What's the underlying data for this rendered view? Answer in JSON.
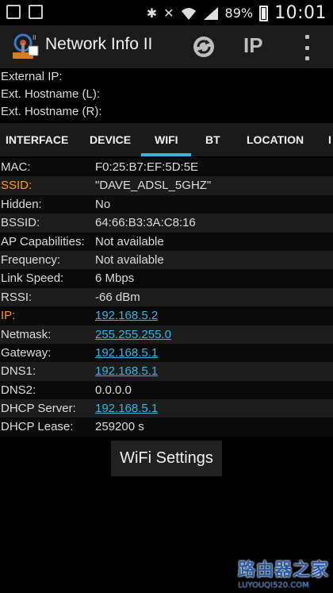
{
  "status": {
    "battery": "89%",
    "time": "10:01"
  },
  "app": {
    "title": "Network Info II",
    "ip_button": "IP"
  },
  "ext": {
    "external_ip_label": "External IP:",
    "ext_hostname_local_label": "Ext. Hostname (L):",
    "ext_hostname_remote_label": "Ext. Hostname (R):"
  },
  "tabs": [
    {
      "label": "INTERFACE"
    },
    {
      "label": "DEVICE"
    },
    {
      "label": "WIFI",
      "selected": true
    },
    {
      "label": "BT"
    },
    {
      "label": "LOCATION"
    },
    {
      "label": "I"
    }
  ],
  "wifi": {
    "rows": [
      {
        "label": "MAC:",
        "value": "F0:25:B7:EF:5D:5E"
      },
      {
        "label": "SSID:",
        "value": "\"DAVE_ADSL_5GHZ\""
      },
      {
        "label": "Hidden:",
        "value": "No"
      },
      {
        "label": "BSSID:",
        "value": "64:66:B3:3A:C8:16"
      },
      {
        "label": "AP Capabilities:",
        "value": "Not available"
      },
      {
        "label": "Frequency:",
        "value": "Not available"
      },
      {
        "label": "Link Speed:",
        "value": "6 Mbps"
      },
      {
        "label": "RSSI:",
        "value": "-66 dBm"
      },
      {
        "label": "IP:",
        "value": "192.168.5.2"
      },
      {
        "label": "Netmask:",
        "value": "255.255.255.0"
      },
      {
        "label": "Gateway:",
        "value": "192.168.5.1"
      },
      {
        "label": "DNS1:",
        "value": "192.168.5.1"
      },
      {
        "label": "DNS2:",
        "value": "0.0.0.0"
      },
      {
        "label": "DHCP Server:",
        "value": "192.168.5.1"
      },
      {
        "label": "DHCP Lease:",
        "value": "259200 s"
      }
    ],
    "settings_button": "WiFi Settings"
  },
  "watermark": {
    "title": "路由器之家",
    "url": "LUYOUQI520.COM"
  },
  "colors": {
    "accent": "#33b5e5",
    "highlight_label": "#ff9a1a"
  },
  "icons": [
    "image-icon",
    "bag-icon",
    "bluetooth-icon",
    "mute-icon",
    "wifi-icon",
    "signal-icon",
    "battery-icon",
    "app-logo",
    "refresh-icon",
    "overflow-menu-icon"
  ]
}
